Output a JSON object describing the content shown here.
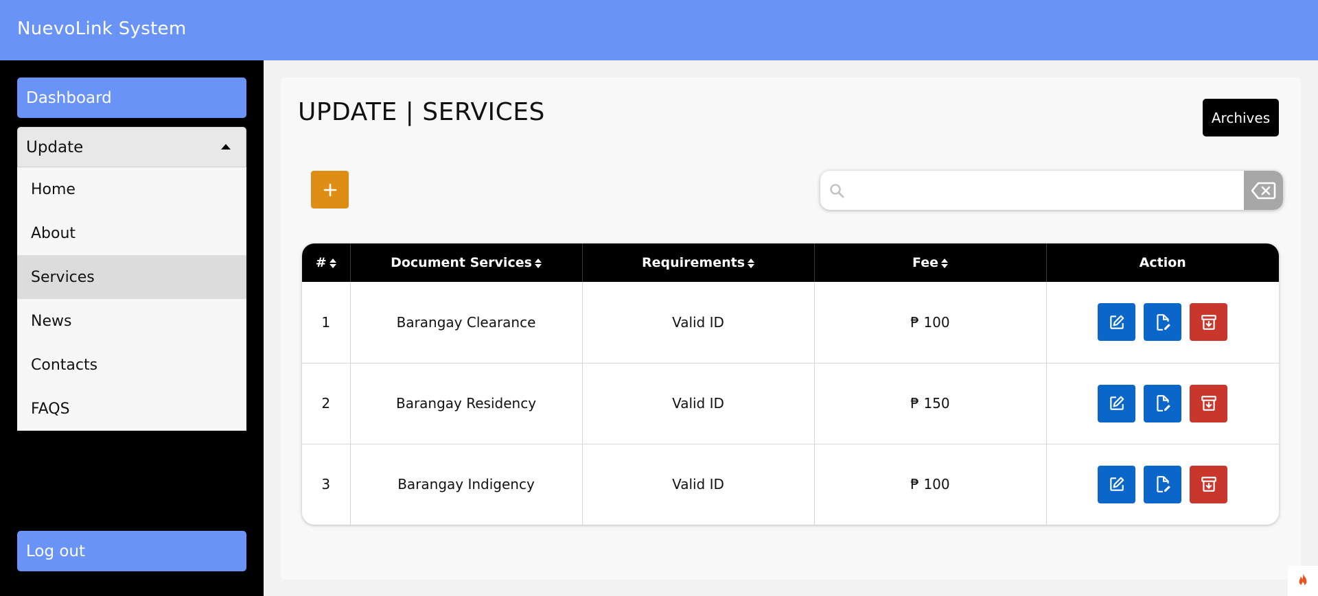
{
  "app": {
    "title": "NuevoLink System"
  },
  "sidebar": {
    "dashboard": "Dashboard",
    "update": "Update",
    "submenu": [
      "Home",
      "About",
      "Services",
      "News",
      "Contacts",
      "FAQS"
    ],
    "active_item": "Services",
    "logout": "Log out"
  },
  "page": {
    "title": "UPDATE | SERVICES",
    "archives_label": "Archives",
    "add_label": "+"
  },
  "search": {
    "value": "",
    "placeholder": ""
  },
  "table": {
    "headers": [
      "#",
      "Document Services",
      "Requirements",
      "Fee",
      "Action"
    ],
    "rows": [
      {
        "num": "1",
        "service": "Barangay Clearance",
        "requirements": "Valid ID",
        "fee": "₱ 100"
      },
      {
        "num": "2",
        "service": "Barangay Residency",
        "requirements": "Valid ID",
        "fee": "₱ 150"
      },
      {
        "num": "3",
        "service": "Barangay Indigency",
        "requirements": "Valid ID",
        "fee": "₱ 100"
      }
    ]
  },
  "colors": {
    "accent": "#6993f7",
    "add_button": "#de8e14",
    "action_blue": "#0b66c9",
    "action_red": "#c9372c"
  },
  "icons": [
    "search-icon",
    "backspace-icon",
    "edit-icon",
    "file-edit-icon",
    "archive-icon",
    "plus-icon",
    "flame-icon"
  ]
}
